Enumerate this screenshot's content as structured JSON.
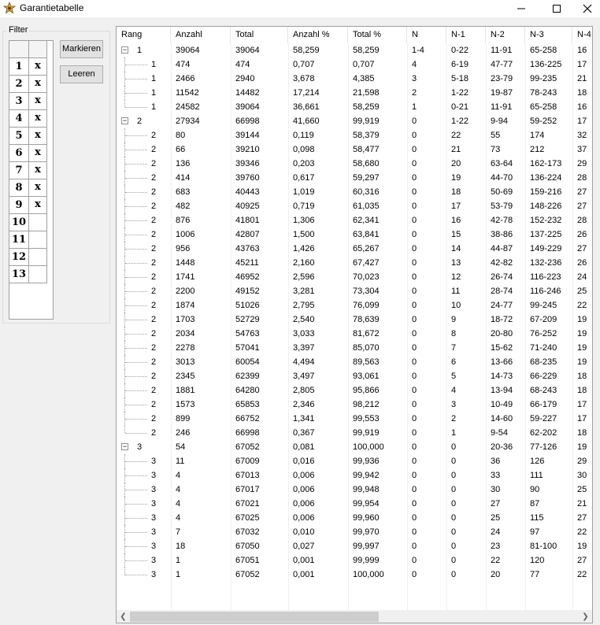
{
  "window": {
    "title": "Garantietabelle"
  },
  "filter": {
    "caption": "Filter",
    "rows": [
      {
        "num": "1",
        "val": "x"
      },
      {
        "num": "2",
        "val": "x"
      },
      {
        "num": "3",
        "val": "x"
      },
      {
        "num": "4",
        "val": "x"
      },
      {
        "num": "5",
        "val": "x"
      },
      {
        "num": "6",
        "val": "x"
      },
      {
        "num": "7",
        "val": "x"
      },
      {
        "num": "8",
        "val": "x"
      },
      {
        "num": "9",
        "val": "x"
      },
      {
        "num": "10",
        "val": ""
      },
      {
        "num": "11",
        "val": ""
      },
      {
        "num": "12",
        "val": ""
      },
      {
        "num": "13",
        "val": ""
      }
    ],
    "mark_label": "Markieren",
    "clear_label": "Leeren"
  },
  "table": {
    "columns": [
      "Rang",
      "Anzahl",
      "Total",
      "Anzahl %",
      "Total %",
      "N",
      "N-1",
      "N-2",
      "N-3",
      "N-4"
    ],
    "rows": [
      {
        "level": 0,
        "expander": "−",
        "cells": [
          "1",
          "39064",
          "39064",
          "58,259",
          "58,259",
          "1-4",
          "0-22",
          "11-91",
          "65-258",
          "16"
        ]
      },
      {
        "level": 1,
        "cells": [
          "1",
          "474",
          "474",
          "0,707",
          "0,707",
          "4",
          "6-19",
          "47-77",
          "136-225",
          "17"
        ]
      },
      {
        "level": 1,
        "cells": [
          "1",
          "2466",
          "2940",
          "3,678",
          "4,385",
          "3",
          "5-18",
          "23-79",
          "99-235",
          "21"
        ]
      },
      {
        "level": 1,
        "cells": [
          "1",
          "11542",
          "14482",
          "17,214",
          "21,598",
          "2",
          "1-22",
          "19-87",
          "78-243",
          "18"
        ]
      },
      {
        "level": 1,
        "last": true,
        "cells": [
          "1",
          "24582",
          "39064",
          "36,661",
          "58,259",
          "1",
          "0-21",
          "11-91",
          "65-258",
          "16"
        ]
      },
      {
        "level": 0,
        "expander": "−",
        "cells": [
          "2",
          "27934",
          "66998",
          "41,660",
          "99,919",
          "0",
          "1-22",
          "9-94",
          "59-252",
          "17"
        ]
      },
      {
        "level": 1,
        "cells": [
          "2",
          "80",
          "39144",
          "0,119",
          "58,379",
          "0",
          "22",
          "55",
          "174",
          "32"
        ]
      },
      {
        "level": 1,
        "cells": [
          "2",
          "66",
          "39210",
          "0,098",
          "58,477",
          "0",
          "21",
          "73",
          "212",
          "37"
        ]
      },
      {
        "level": 1,
        "cells": [
          "2",
          "136",
          "39346",
          "0,203",
          "58,680",
          "0",
          "20",
          "63-64",
          "162-173",
          "29"
        ]
      },
      {
        "level": 1,
        "cells": [
          "2",
          "414",
          "39760",
          "0,617",
          "59,297",
          "0",
          "19",
          "44-70",
          "136-224",
          "28"
        ]
      },
      {
        "level": 1,
        "cells": [
          "2",
          "683",
          "40443",
          "1,019",
          "60,316",
          "0",
          "18",
          "50-69",
          "159-216",
          "27"
        ]
      },
      {
        "level": 1,
        "cells": [
          "2",
          "482",
          "40925",
          "0,719",
          "61,035",
          "0",
          "17",
          "53-79",
          "148-226",
          "27"
        ]
      },
      {
        "level": 1,
        "cells": [
          "2",
          "876",
          "41801",
          "1,306",
          "62,341",
          "0",
          "16",
          "42-78",
          "152-232",
          "28"
        ]
      },
      {
        "level": 1,
        "cells": [
          "2",
          "1006",
          "42807",
          "1,500",
          "63,841",
          "0",
          "15",
          "38-86",
          "137-225",
          "26"
        ]
      },
      {
        "level": 1,
        "cells": [
          "2",
          "956",
          "43763",
          "1,426",
          "65,267",
          "0",
          "14",
          "44-87",
          "149-229",
          "27"
        ]
      },
      {
        "level": 1,
        "cells": [
          "2",
          "1448",
          "45211",
          "2,160",
          "67,427",
          "0",
          "13",
          "42-82",
          "132-236",
          "26"
        ]
      },
      {
        "level": 1,
        "cells": [
          "2",
          "1741",
          "46952",
          "2,596",
          "70,023",
          "0",
          "12",
          "26-74",
          "116-223",
          "24"
        ]
      },
      {
        "level": 1,
        "cells": [
          "2",
          "2200",
          "49152",
          "3,281",
          "73,304",
          "0",
          "11",
          "28-74",
          "116-246",
          "25"
        ]
      },
      {
        "level": 1,
        "cells": [
          "2",
          "1874",
          "51026",
          "2,795",
          "76,099",
          "0",
          "10",
          "24-77",
          "99-245",
          "22"
        ]
      },
      {
        "level": 1,
        "cells": [
          "2",
          "1703",
          "52729",
          "2,540",
          "78,639",
          "0",
          "9",
          "18-72",
          "67-209",
          "19"
        ]
      },
      {
        "level": 1,
        "cells": [
          "2",
          "2034",
          "54763",
          "3,033",
          "81,672",
          "0",
          "8",
          "20-80",
          "76-252",
          "19"
        ]
      },
      {
        "level": 1,
        "cells": [
          "2",
          "2278",
          "57041",
          "3,397",
          "85,070",
          "0",
          "7",
          "15-62",
          "71-240",
          "19"
        ]
      },
      {
        "level": 1,
        "cells": [
          "2",
          "3013",
          "60054",
          "4,494",
          "89,563",
          "0",
          "6",
          "13-66",
          "68-235",
          "19"
        ]
      },
      {
        "level": 1,
        "cells": [
          "2",
          "2345",
          "62399",
          "3,497",
          "93,061",
          "0",
          "5",
          "14-73",
          "66-229",
          "18"
        ]
      },
      {
        "level": 1,
        "cells": [
          "2",
          "1881",
          "64280",
          "2,805",
          "95,866",
          "0",
          "4",
          "13-94",
          "68-243",
          "18"
        ]
      },
      {
        "level": 1,
        "cells": [
          "2",
          "1573",
          "65853",
          "2,346",
          "98,212",
          "0",
          "3",
          "10-49",
          "66-179",
          "17"
        ]
      },
      {
        "level": 1,
        "cells": [
          "2",
          "899",
          "66752",
          "1,341",
          "99,553",
          "0",
          "2",
          "14-60",
          "59-227",
          "17"
        ]
      },
      {
        "level": 1,
        "last": true,
        "cells": [
          "2",
          "246",
          "66998",
          "0,367",
          "99,919",
          "0",
          "1",
          "9-54",
          "62-202",
          "18"
        ]
      },
      {
        "level": 0,
        "expander": "−",
        "cells": [
          "3",
          "54",
          "67052",
          "0,081",
          "100,000",
          "0",
          "0",
          "20-36",
          "77-126",
          "19"
        ]
      },
      {
        "level": 1,
        "cells": [
          "3",
          "11",
          "67009",
          "0,016",
          "99,936",
          "0",
          "0",
          "36",
          "126",
          "29"
        ]
      },
      {
        "level": 1,
        "cells": [
          "3",
          "4",
          "67013",
          "0,006",
          "99,942",
          "0",
          "0",
          "33",
          "111",
          "30"
        ]
      },
      {
        "level": 1,
        "cells": [
          "3",
          "4",
          "67017",
          "0,006",
          "99,948",
          "0",
          "0",
          "30",
          "90",
          "25"
        ]
      },
      {
        "level": 1,
        "cells": [
          "3",
          "4",
          "67021",
          "0,006",
          "99,954",
          "0",
          "0",
          "27",
          "87",
          "21"
        ]
      },
      {
        "level": 1,
        "cells": [
          "3",
          "4",
          "67025",
          "0,006",
          "99,960",
          "0",
          "0",
          "25",
          "115",
          "27"
        ]
      },
      {
        "level": 1,
        "cells": [
          "3",
          "7",
          "67032",
          "0,010",
          "99,970",
          "0",
          "0",
          "24",
          "97",
          "22"
        ]
      },
      {
        "level": 1,
        "cells": [
          "3",
          "18",
          "67050",
          "0,027",
          "99,997",
          "0",
          "0",
          "23",
          "81-100",
          "19"
        ]
      },
      {
        "level": 1,
        "cells": [
          "3",
          "1",
          "67051",
          "0,001",
          "99,999",
          "0",
          "0",
          "22",
          "120",
          "27"
        ]
      },
      {
        "level": 1,
        "last": true,
        "cells": [
          "3",
          "1",
          "67052",
          "0,001",
          "100,000",
          "0",
          "0",
          "20",
          "77",
          "22"
        ]
      }
    ]
  }
}
